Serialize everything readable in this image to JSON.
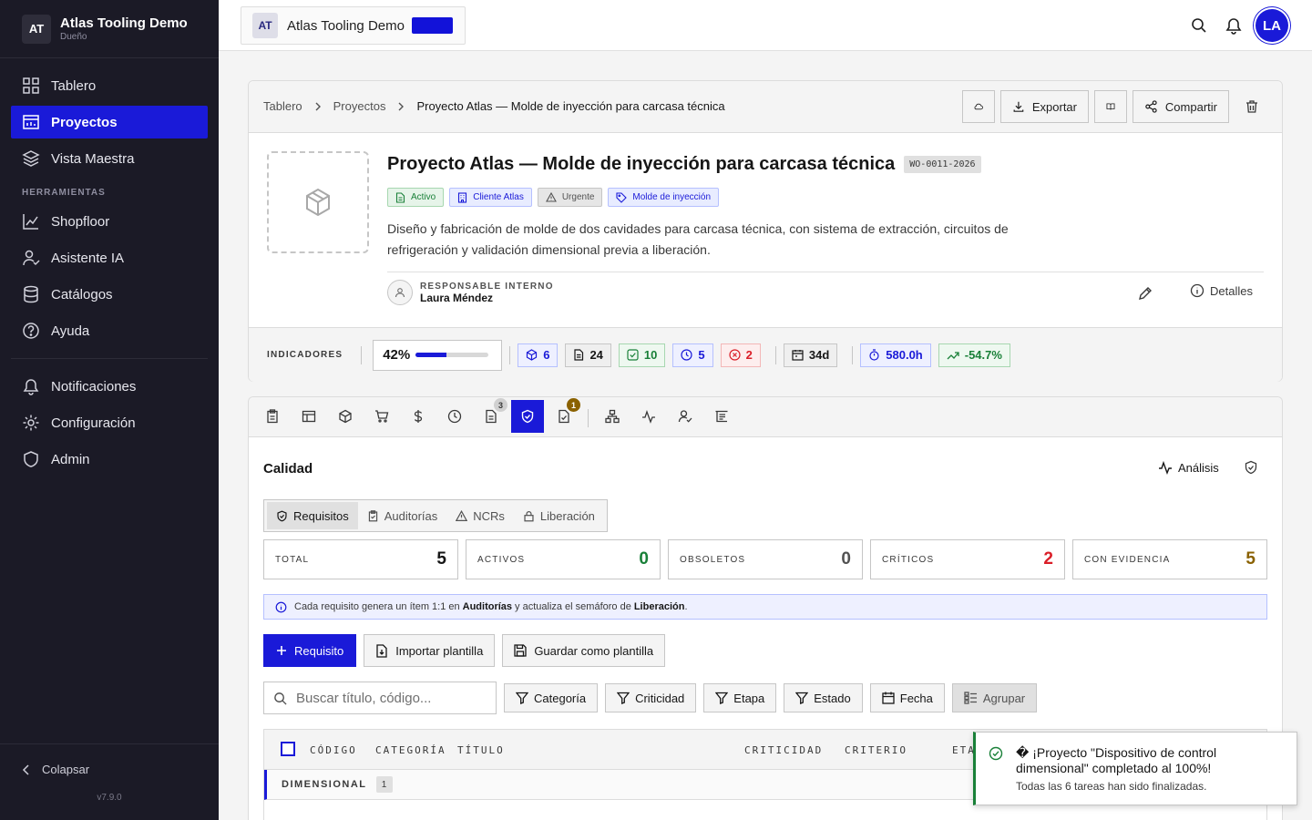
{
  "sidebar": {
    "logo": "AT",
    "org_name": "Atlas Tooling Demo",
    "org_role": "Dueño",
    "items": [
      {
        "label": "Tablero",
        "icon": "dashboard-icon"
      },
      {
        "label": "Proyectos",
        "icon": "projects-icon",
        "active": true
      },
      {
        "label": "Vista Maestra",
        "icon": "layers-icon"
      }
    ],
    "tools_heading": "HERRAMIENTAS",
    "tools": [
      {
        "label": "Shopfloor",
        "icon": "chart-icon"
      },
      {
        "label": "Asistente IA",
        "icon": "user-check-icon"
      },
      {
        "label": "Catálogos",
        "icon": "database-icon"
      },
      {
        "label": "Ayuda",
        "icon": "help-icon"
      }
    ],
    "bottom": [
      {
        "label": "Notificaciones",
        "icon": "bell-icon"
      },
      {
        "label": "Configuración",
        "icon": "gear-icon"
      },
      {
        "label": "Admin",
        "icon": "shield-icon"
      }
    ],
    "collapse_label": "Colapsar",
    "version": "v7.9.0"
  },
  "topbar": {
    "ws_logo": "AT",
    "ws_name": "Atlas Tooling Demo",
    "ws_color": "#1212d9",
    "avatar": "LA"
  },
  "project": {
    "breadcrumb": [
      "Tablero",
      "Proyectos",
      "Proyecto Atlas — Molde de inyección para carcasa técnica"
    ],
    "export_label": "Exportar",
    "share_label": "Compartir",
    "title": "Proyecto Atlas — Molde de inyección para carcasa técnica",
    "code": "WO-0011-2026",
    "tags": [
      {
        "label": "Activo",
        "color": "green"
      },
      {
        "label": "Cliente Atlas",
        "color": "blue"
      },
      {
        "label": "Urgente",
        "color": "gray"
      },
      {
        "label": "Molde de inyección",
        "color": "blue"
      }
    ],
    "description": "Diseño y fabricación de molde de dos cavidades para carcasa técnica, con sistema de extracción, circuitos de refrigeración y validación dimensional previa a liberación.",
    "owner_label": "RESPONSABLE INTERNO",
    "owner_name": "Laura Méndez",
    "details_label": "Detalles",
    "indicators_label": "INDICADORES",
    "progress_text": "42%",
    "progress_value": 0.42,
    "stats": [
      {
        "value": "6",
        "icon": "cube-icon",
        "color": "blue"
      },
      {
        "value": "24",
        "icon": "document-icon",
        "color": "gray"
      },
      {
        "value": "10",
        "icon": "check-icon",
        "color": "green"
      },
      {
        "value": "5",
        "icon": "clock-icon",
        "color": "blue"
      },
      {
        "value": "2",
        "icon": "x-circle-icon",
        "color": "red"
      },
      {
        "value": "34d",
        "icon": "calendar-icon",
        "color": "gray"
      },
      {
        "value": "580.0h",
        "icon": "timer-icon",
        "color": "blue"
      },
      {
        "value": "-54.7%",
        "icon": "trend-icon",
        "color": "green"
      }
    ]
  },
  "tabs": {
    "badge_docs": "3",
    "badge_tasks": "1"
  },
  "quality": {
    "title": "Calidad",
    "analysis_label": "Análisis",
    "subtabs": [
      "Requisitos",
      "Auditorías",
      "NCRs",
      "Liberación"
    ],
    "kpis": [
      {
        "label": "TOTAL",
        "value": "5",
        "color": "#161616"
      },
      {
        "label": "ACTIVOS",
        "value": "0",
        "color": "#198038"
      },
      {
        "label": "OBSOLETOS",
        "value": "0",
        "color": "#525252"
      },
      {
        "label": "CRÍTICOS",
        "value": "2",
        "color": "#da1e28"
      },
      {
        "label": "CON EVIDENCIA",
        "value": "5",
        "color": "#8a6100"
      }
    ],
    "info_a": "Cada requisito genera un ítem 1:1 en",
    "info_b": "Auditorías",
    "info_c": "y actualiza el semáforo de",
    "info_d": "Liberación",
    "info_e": ".",
    "add_label": "Requisito",
    "import_label": "Importar plantilla",
    "save_template_label": "Guardar como plantilla",
    "search_placeholder": "Buscar título, código...",
    "filters": [
      "Categoría",
      "Criticidad",
      "Etapa",
      "Estado",
      "Fecha"
    ],
    "group_label": "Agrupar",
    "columns": [
      "CÓDIGO",
      "CATEGORÍA",
      "TÍTULO",
      "CRITICIDAD",
      "CRITERIO",
      "ETA"
    ],
    "group_name": "DIMENSIONAL",
    "group_count": "1"
  },
  "toast": {
    "title": "� ¡Proyecto \"Dispositivo de control dimensional\" completado al 100%!",
    "message": "Todas las 6 tareas han sido finalizadas."
  }
}
